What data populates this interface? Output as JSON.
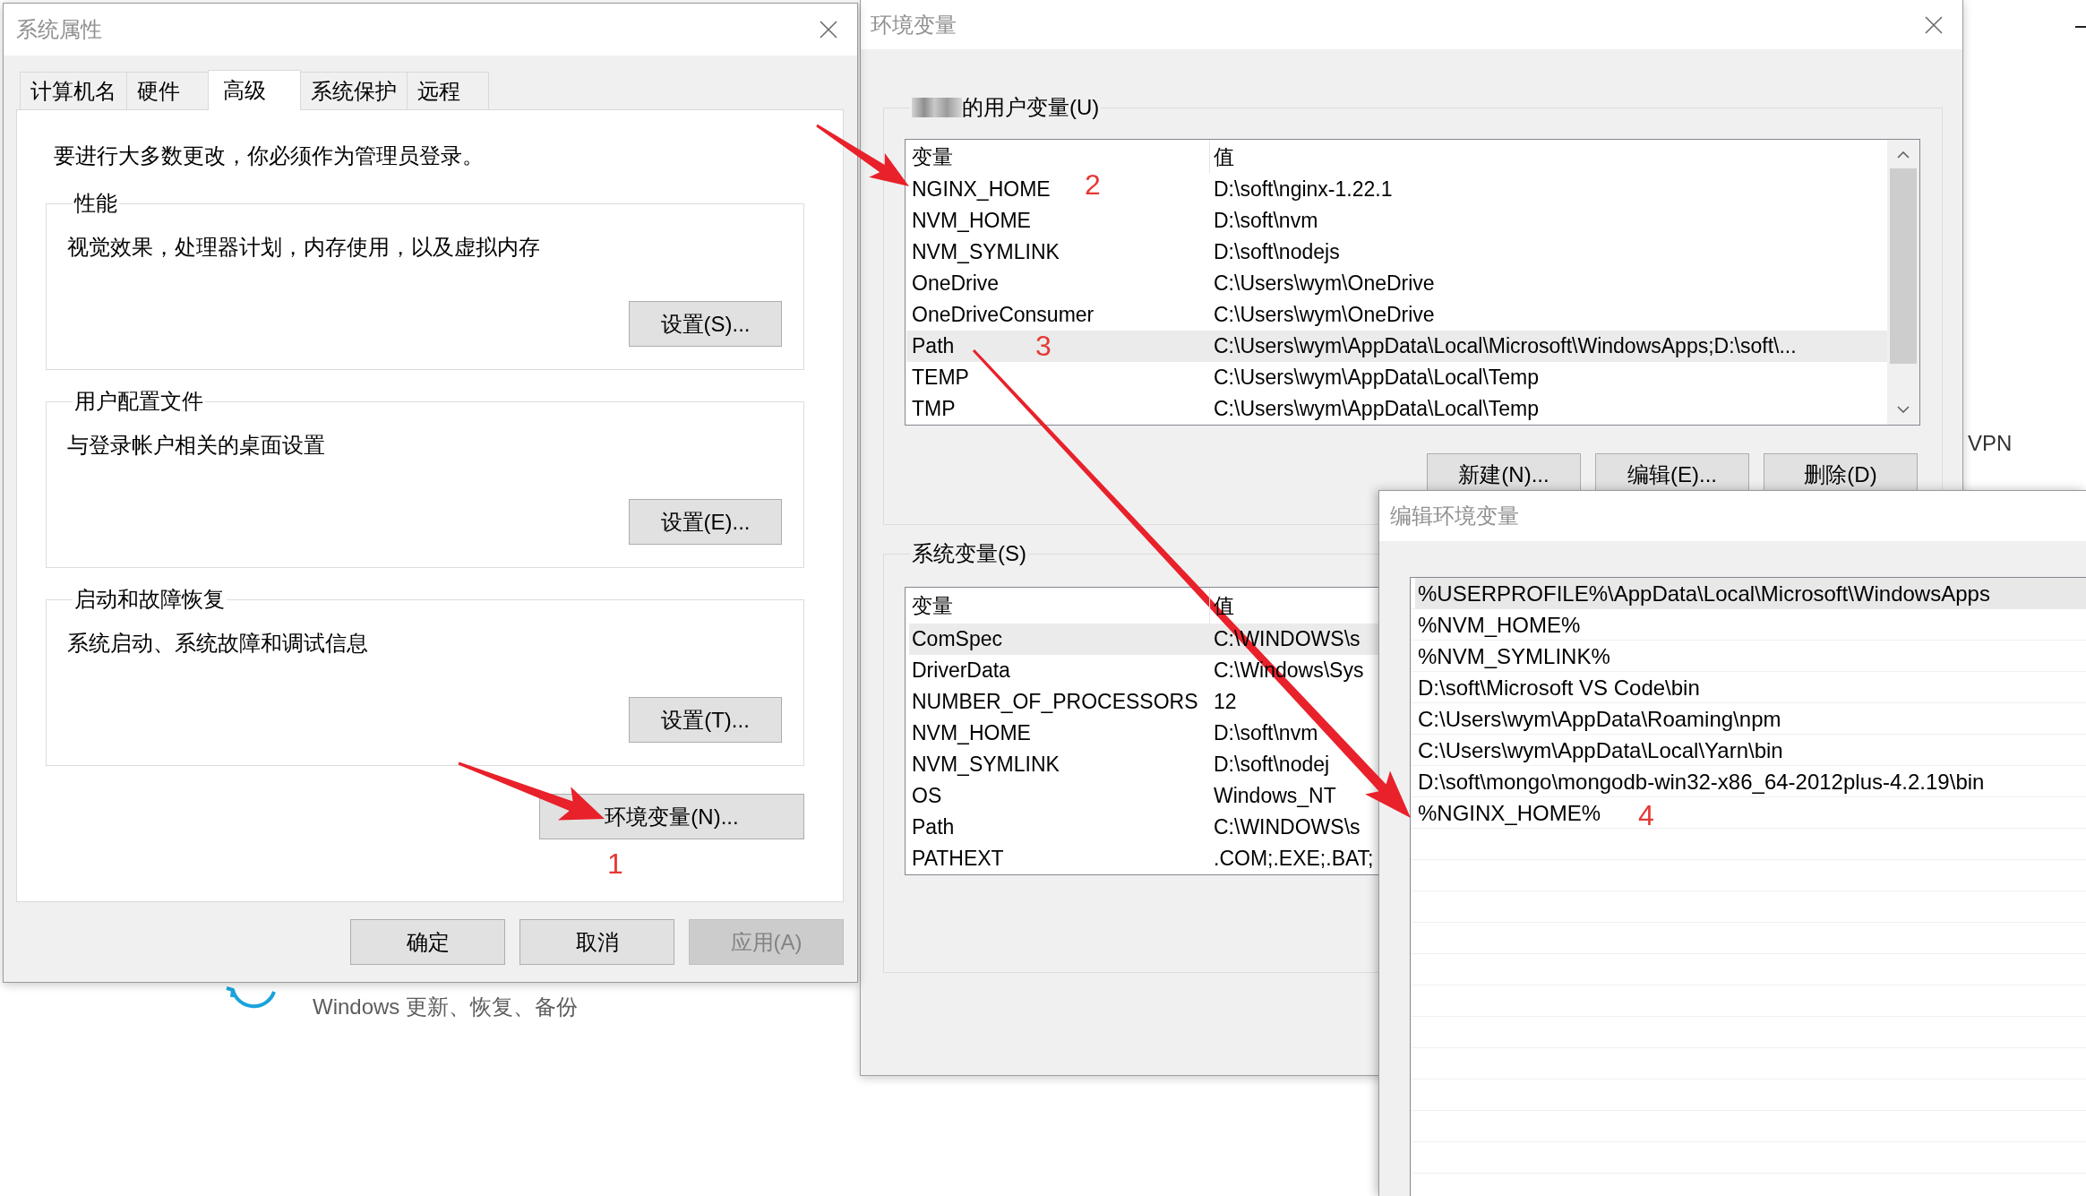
{
  "background_page": {
    "caption": "Windows 更新、恢复、备份",
    "side_label": "VPN"
  },
  "system_properties": {
    "title": "系统属性",
    "tabs": [
      {
        "label": "计算机名",
        "selected": false
      },
      {
        "label": "硬件",
        "selected": false
      },
      {
        "label": "高级",
        "selected": true
      },
      {
        "label": "系统保护",
        "selected": false
      },
      {
        "label": "远程",
        "selected": false
      }
    ],
    "notice": "要进行大多数更改，你必须作为管理员登录。",
    "groups": [
      {
        "title": "性能",
        "description": "视觉效果，处理器计划，内存使用，以及虚拟内存",
        "button": "设置(S)..."
      },
      {
        "title": "用户配置文件",
        "description": "与登录帐户相关的桌面设置",
        "button": "设置(E)..."
      },
      {
        "title": "启动和故障恢复",
        "description": "系统启动、系统故障和调试信息",
        "button": "设置(T)..."
      }
    ],
    "environment_button": "环境变量(N)...",
    "environment_step": "1",
    "buttons": [
      {
        "label": "确定",
        "disabled": false
      },
      {
        "label": "取消",
        "disabled": false
      },
      {
        "label": "应用(A)",
        "disabled": true
      }
    ]
  },
  "environment_variables": {
    "title": "环境变量",
    "user_variables": {
      "title": "的用户变量(U)",
      "columns": [
        "变量",
        "值"
      ],
      "rows": [
        {
          "name": "NGINX_HOME",
          "value": "D:\\soft\\nginx-1.22.1",
          "selected": false,
          "step": "2"
        },
        {
          "name": "NVM_HOME",
          "value": "D:\\soft\\nvm",
          "selected": false
        },
        {
          "name": "NVM_SYMLINK",
          "value": "D:\\soft\\nodejs",
          "selected": false
        },
        {
          "name": "OneDrive",
          "value": "C:\\Users\\wym\\OneDrive",
          "selected": false
        },
        {
          "name": "OneDriveConsumer",
          "value": "C:\\Users\\wym\\OneDrive",
          "selected": false
        },
        {
          "name": "Path",
          "value": "C:\\Users\\wym\\AppData\\Local\\Microsoft\\WindowsApps;D:\\soft\\...",
          "selected": true,
          "step": "3"
        },
        {
          "name": "TEMP",
          "value": "C:\\Users\\wym\\AppData\\Local\\Temp",
          "selected": false
        },
        {
          "name": "TMP",
          "value": "C:\\Users\\wym\\AppData\\Local\\Temp",
          "selected": false
        }
      ],
      "buttons": [
        "新建(N)...",
        "编辑(E)...",
        "删除(D)"
      ]
    },
    "system_variables": {
      "title": "系统变量(S)",
      "columns": [
        "变量",
        "值"
      ],
      "rows": [
        {
          "name": "ComSpec",
          "value": "C:\\WINDOWS\\s",
          "selected": true
        },
        {
          "name": "DriverData",
          "value": "C:\\Windows\\Sys",
          "selected": false
        },
        {
          "name": "NUMBER_OF_PROCESSORS",
          "value": "12",
          "selected": false
        },
        {
          "name": "NVM_HOME",
          "value": "D:\\soft\\nvm",
          "selected": false
        },
        {
          "name": "NVM_SYMLINK",
          "value": "D:\\soft\\nodej",
          "selected": false
        },
        {
          "name": "OS",
          "value": "Windows_NT",
          "selected": false
        },
        {
          "name": "Path",
          "value": "C:\\WINDOWS\\s",
          "selected": false
        },
        {
          "name": "PATHEXT",
          "value": ".COM;.EXE;.BAT;",
          "selected": false
        }
      ]
    }
  },
  "edit_variable": {
    "title": "编辑环境变量",
    "entries": [
      {
        "text": "%USERPROFILE%\\AppData\\Local\\Microsoft\\WindowsApps",
        "selected": true
      },
      {
        "text": "%NVM_HOME%",
        "selected": false
      },
      {
        "text": "%NVM_SYMLINK%",
        "selected": false
      },
      {
        "text": "D:\\soft\\Microsoft VS Code\\bin",
        "selected": false
      },
      {
        "text": "C:\\Users\\wym\\AppData\\Roaming\\npm",
        "selected": false
      },
      {
        "text": "C:\\Users\\wym\\AppData\\Local\\Yarn\\bin",
        "selected": false
      },
      {
        "text": "D:\\soft\\mongo\\mongodb-win32-x86_64-2012plus-4.2.19\\bin",
        "selected": false
      },
      {
        "text": "%NGINX_HOME%",
        "selected": false,
        "step": "4"
      }
    ]
  }
}
